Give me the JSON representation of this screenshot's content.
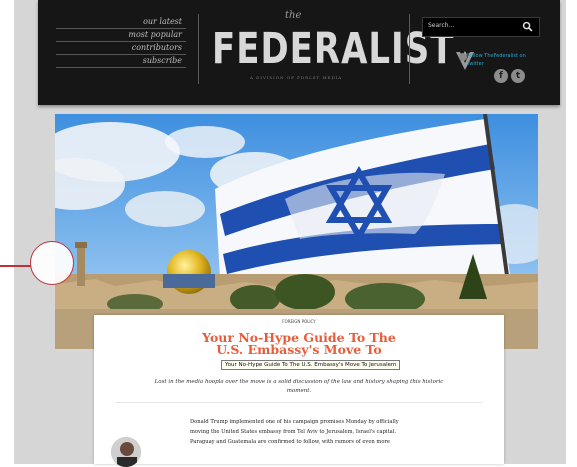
{
  "nav": {
    "items": [
      "our latest",
      "most popular",
      "contributors",
      "subscribe"
    ]
  },
  "logo": {
    "the": "the",
    "name": "FEDERALIST",
    "tagline": "A DIVISION OF FDRLST MEDIA"
  },
  "search": {
    "placeholder": "Search...",
    "icon": "search-icon"
  },
  "follow": {
    "text": "Follow TheFederalist on Twitter"
  },
  "social": {
    "facebook": "f",
    "twitter": "t"
  },
  "article": {
    "kicker": "FOREIGN POLICY",
    "title_line1": "Your No-Hype Guide To The",
    "title_line2": "U.S. Embassy's Move To",
    "tooltip": "Your No-Hype Guide To The U.S. Embassy's Move To Jerusalem",
    "dek_line1": "Lost in the media hoopla over the move is a solid discussion of the law and history shaping this historic",
    "dek_line2": "moment.",
    "body_line1": "Donald Trump implemented one of his campaign promises Monday by officially",
    "body_line2": "moving the United States embassy from Tel Aviv to Jerusalem, Israel's capital.",
    "body_line3": "Paraguay and Guatemala are confirmed to follow, with rumors of even more"
  },
  "colors": {
    "header_bg": "#161616",
    "title": "#e85c3a",
    "callout": "#c0303a",
    "twitter_link": "#2aa3cf"
  }
}
